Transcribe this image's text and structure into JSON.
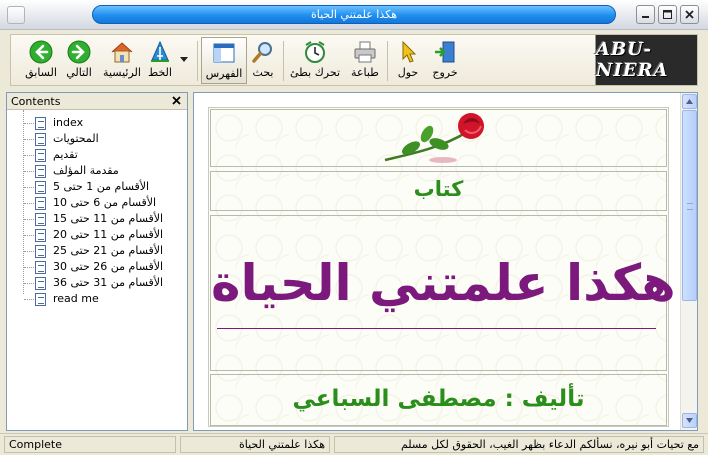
{
  "window": {
    "title": "هكذا علمتني الحياة"
  },
  "toolbar": {
    "buttons": [
      {
        "id": "back",
        "label": "السابق",
        "icon": "back-arrow-icon"
      },
      {
        "id": "next",
        "label": "التالي",
        "icon": "forward-arrow-icon"
      },
      {
        "id": "home",
        "label": "الرئيسية",
        "icon": "home-icon"
      },
      {
        "id": "font",
        "label": "الخط",
        "icon": "font-icon"
      },
      {
        "id": "contents",
        "label": "الفهرس",
        "icon": "contents-pane-icon"
      },
      {
        "id": "search",
        "label": "بحث",
        "icon": "magnifier-icon"
      },
      {
        "id": "autoscroll",
        "label": "تحرك بطئ",
        "icon": "clock-icon"
      },
      {
        "id": "print",
        "label": "طباعة",
        "icon": "printer-icon"
      },
      {
        "id": "about",
        "label": "حول",
        "icon": "pointer-icon"
      },
      {
        "id": "exit",
        "label": "خروج",
        "icon": "exit-door-icon"
      }
    ],
    "logo_text": "ABU-NIERA"
  },
  "contents_panel": {
    "header": "Contents",
    "items": [
      "index",
      "المحتويات",
      "تقديم",
      "مقدمة المؤلف",
      "الأقسام من 1 حتى 5",
      "الأقسام من 6 حتى 10",
      "الأقسام من 11 حتى 15",
      "الأقسام من 11 حتى 20",
      "الأقسام من 21 حتى 25",
      "الأقسام من 26 حتى 30",
      "الأقسام من 31 حتى 36",
      "read me"
    ]
  },
  "document": {
    "label_book": "كتاب",
    "title": "هكذا علمتني الحياة",
    "author": "تأليف : مصطفى السباعي"
  },
  "statusbar": {
    "state": "Complete",
    "page_title": "هكذا علمتني الحياة",
    "message": "مع تحيات أبو نيره، نسألكم الدعاء بظهر الغيب، الحقوق لكل مسلم"
  },
  "colors": {
    "title_purple": "#7b1a7c",
    "green_text": "#2a8f1a",
    "titlebar_blue": "#1f8ff0"
  }
}
